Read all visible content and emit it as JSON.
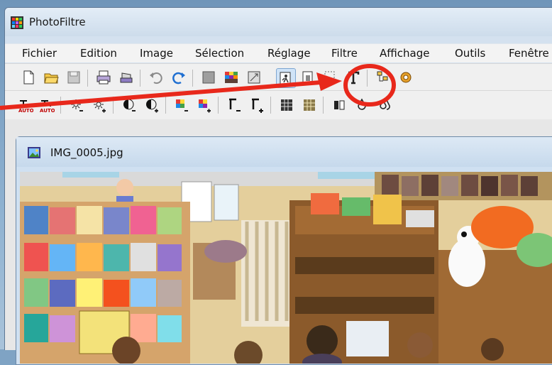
{
  "window": {
    "title": "PhotoFiltre"
  },
  "menu": [
    "Fichier",
    "Edition",
    "Image",
    "Sélection",
    "Réglage",
    "Filtre",
    "Affichage",
    "Outils",
    "Fenêtre"
  ],
  "toolbar_badges": {
    "auto_1": "AUTO",
    "auto_2": "AUTO"
  },
  "document": {
    "title": "IMG_0005.jpg"
  },
  "colors": {
    "annotation": "#e8281b",
    "title_bar": "#d4e1ef",
    "toolbar": "#f0f0f0"
  },
  "icons": [
    "new-file-icon",
    "open-folder-icon",
    "save-icon",
    "print-icon",
    "scanner-icon",
    "undo-icon",
    "redo-icon",
    "gray-square-icon",
    "color-grid-icon",
    "image-size-icon",
    "automation-icon",
    "transform-icon",
    "selection-icon",
    "text-icon",
    "explorer-icon",
    "plugin-gear-icon"
  ]
}
